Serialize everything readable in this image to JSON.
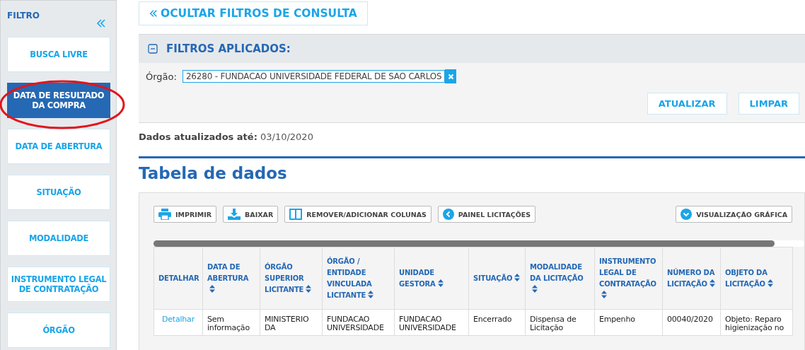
{
  "sidebar": {
    "title": "FILTRO",
    "items": [
      {
        "label": "BUSCA LIVRE",
        "selected": false,
        "circled": false
      },
      {
        "label": "DATA DE RESULTADO DA COMPRA",
        "selected": true,
        "circled": true
      },
      {
        "label": "DATA DE ABERTURA",
        "selected": false,
        "circled": false
      },
      {
        "label": "SITUAÇÃO",
        "selected": false,
        "circled": false
      },
      {
        "label": "MODALIDADE",
        "selected": false,
        "circled": false
      },
      {
        "label": "INSTRUMENTO LEGAL DE CONTRATAÇÃO",
        "selected": false,
        "circled": false
      },
      {
        "label": "ÓRGÃO",
        "selected": false,
        "circled": false
      }
    ]
  },
  "hide_filters_button": "OCULTAR FILTROS DE CONSULTA",
  "applied_filters": {
    "title": "FILTROS APLICADOS:",
    "expanded": true,
    "filters": [
      {
        "label": "Órgão:",
        "value": "26280 - FUNDACAO UNIVERSIDADE FEDERAL DE SAO CARLOS"
      }
    ],
    "buttons": [
      "ATUALIZAR",
      "LIMPAR"
    ]
  },
  "updated": {
    "label": "Dados atualizados até:",
    "value": "03/10/2020"
  },
  "table_title": "Tabela de dados",
  "toolbar": [
    {
      "kind": "print",
      "label": "IMPRIMIR"
    },
    {
      "kind": "download",
      "label": "BAIXAR"
    },
    {
      "kind": "columns",
      "label": "REMOVER/ADICIONAR COLUNAS"
    },
    {
      "kind": "back",
      "label": "PAINEL LICITAÇÕES"
    },
    {
      "kind": "chart",
      "label": "VISUALIZAÇÃO GRÁFICA"
    }
  ],
  "table": {
    "columns": [
      {
        "label": "DETALHAR",
        "sortable": false
      },
      {
        "label": "DATA DE ABERTURA",
        "sortable": true
      },
      {
        "label": "ÓRGÃO SUPERIOR LICITANTE",
        "sortable": true
      },
      {
        "label": "ÓRGÃO / ENTIDADE VINCULADA LICITANTE",
        "sortable": true
      },
      {
        "label": "UNIDADE GESTORA",
        "sortable": true
      },
      {
        "label": "SITUAÇÃO",
        "sortable": true
      },
      {
        "label": "MODALIDADE DA LICITAÇÃO",
        "sortable": true
      },
      {
        "label": "INSTRUMENTO LEGAL DE CONTRATAÇÃO",
        "sortable": true
      },
      {
        "label": "NÚMERO DA LICITAÇÃO",
        "sortable": true
      },
      {
        "label": "OBJETO DA LICITAÇÃO",
        "sortable": true
      }
    ],
    "rows": [
      [
        "Detalhar",
        "Sem informação",
        "MINISTERIO DA",
        "FUNDACAO UNIVERSIDADE",
        "FUNDACAO UNIVERSIDADE",
        "Encerrado",
        "Dispensa de Licitação",
        "Empenho",
        "00040/2020",
        "Objeto: Reparo higienização no"
      ]
    ]
  }
}
